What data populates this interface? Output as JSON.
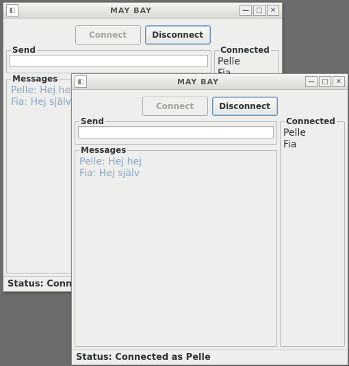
{
  "windows": [
    {
      "title": "MAY BAY",
      "connect_label": "Connect",
      "disconnect_label": "Disconnect",
      "send_legend": "Send",
      "send_value": "",
      "messages_legend": "Messages",
      "messages_text": "Pelle: Hej hej\nFia: Hej själv",
      "connected_legend": "Connected",
      "connected_list": "Pelle\nFia",
      "status": "Status: Connec"
    },
    {
      "title": "MAY BAY",
      "connect_label": "Connect",
      "disconnect_label": "Disconnect",
      "send_legend": "Send",
      "send_value": "",
      "messages_legend": "Messages",
      "messages_text": "Pelle: Hej hej\nFia: Hej själv",
      "connected_legend": "Connected",
      "connected_list": "Pelle\nFia",
      "status": "Status: Connected as Pelle"
    }
  ],
  "icons": {
    "app": "◧",
    "minimize": "—",
    "maximize": "□",
    "close": "✕"
  }
}
